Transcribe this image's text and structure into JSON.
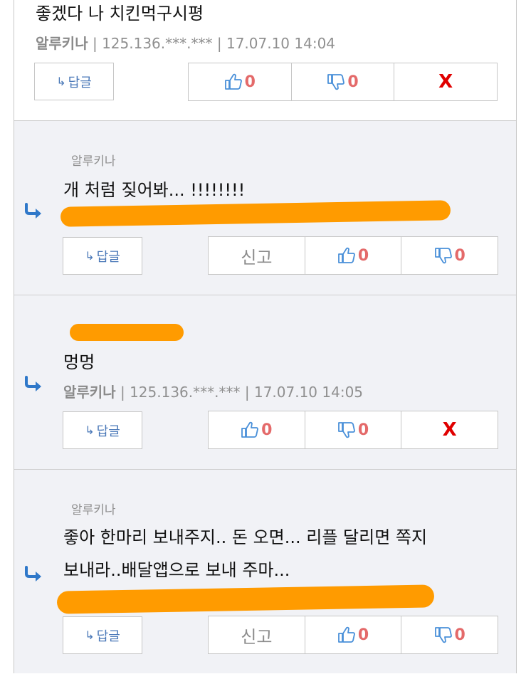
{
  "comments": [
    {
      "text": "좋겠다 나 치킨먹구시평",
      "author": "알루키나",
      "ip": "125.136.***.***",
      "date": "17.07.10 14:04",
      "reply_label": "답글",
      "likes": "0",
      "dislikes": "0",
      "delete_label": "X"
    },
    {
      "small_author": "알루키나",
      "text": "개 처럼 짖어봐... !!!!!!!!",
      "reply_label": "답글",
      "report_label": "신고",
      "likes": "0",
      "dislikes": "0"
    },
    {
      "text": "멍멍",
      "author": "알루키나",
      "ip": "125.136.***.***",
      "date": "17.07.10 14:05",
      "reply_label": "답글",
      "likes": "0",
      "dislikes": "0",
      "delete_label": "X"
    },
    {
      "small_author": "알루키나",
      "text_line1": "좋아 한마리 보내주지.. 돈 오면... 리플 달리면 쪽지",
      "text_line2": "보내라..배달앱으로 보내 주마...",
      "reply_label": "답글",
      "report_label": "신고",
      "likes": "0",
      "dislikes": "0"
    }
  ],
  "meta_separator": "|",
  "colors": {
    "accent_blue": "#4a78b8",
    "count_red": "#e46a6a",
    "delete_red": "#e00000",
    "redaction_orange": "#ff9b00",
    "nested_bg": "#f1f2f6"
  },
  "icons": [
    "reply-arrow-icon",
    "thumbs-up-icon",
    "thumbs-down-icon"
  ]
}
